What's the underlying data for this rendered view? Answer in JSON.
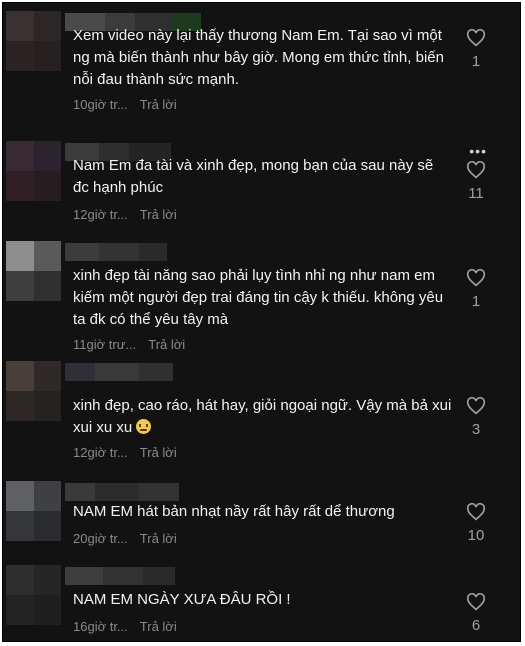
{
  "comments": [
    {
      "text": "Xem video này lại thấy thương Nam Em. Tại sao vì một ng mà biến thành như bây giờ. Mong em thức tỉnh, biến nỗi đau thành sức mạnh.",
      "time": "10giờ tr...",
      "reply": "Trả lời",
      "likes": "1",
      "avatar_colors": [
        "#3a3232",
        "#2c2626",
        "#2a2424",
        "#262020"
      ],
      "name_colors": [
        "#4a4a4a",
        "#3b3b3b",
        "#2f2f2f",
        "#1e3a1e"
      ]
    },
    {
      "text": "Nam Em đa tài và xinh đẹp, mong bạn của sau này sẽ đc hạnh phúc",
      "time": "12giờ tr...",
      "reply": "Trả lời",
      "likes": "11",
      "more": "•••",
      "avatar_colors": [
        "#3a2a33",
        "#2c2330",
        "#302026",
        "#251d22"
      ],
      "name_colors": [
        "#3b3b3b",
        "#2e2e2e",
        "#242424"
      ]
    },
    {
      "text": "xinh đẹp tài năng sao phải lụy tình nhỉ ng như nam em kiếm một người đẹp trai đáng tin cậy k thiếu. không yêu ta đk có thể yêu tây mà",
      "time": "11giờ trư...",
      "reply": "Trả lời",
      "likes": "1",
      "avatar_colors": [
        "#8e8e8e",
        "#5a5a5a",
        "#3e3e3e",
        "#303030"
      ],
      "name_colors": [
        "#3c3c3c",
        "#333333",
        "#2a2a2a"
      ]
    },
    {
      "text": "xinh đẹp, cao ráo, hát hay, giỏi ngoại ngữ. Vậy mà bả xui xui xu xu",
      "time": "12giờ tr...",
      "reply": "Trả lời",
      "likes": "3",
      "avatar_colors": [
        "#4a3e3a",
        "#2f2a28",
        "#2d2826",
        "#262220"
      ],
      "name_colors": [
        "#2f2f3a",
        "#3a3a3a",
        "#303030"
      ]
    },
    {
      "text": "NAM EM hát bản nhạt nầy rất hây rất dể thương",
      "time": "20giờ tr...",
      "reply": "Trả lời",
      "likes": "10",
      "avatar_colors": [
        "#5e6064",
        "#3e4044",
        "#34363a",
        "#2a2c30"
      ],
      "name_colors": [
        "#3a3a3a",
        "#2c2c2c",
        "#333333"
      ]
    },
    {
      "text": "NAM EM NGÀY XƯA ĐÂU RỒI !",
      "time": "16giờ tr...",
      "reply": "Trả lời",
      "likes": "6",
      "avatar_colors": [
        "#2e2e2e",
        "#262626",
        "#232323",
        "#1f1f1f"
      ],
      "name_colors": [
        "#3e3e3e",
        "#333333",
        "#2a2a2a"
      ]
    }
  ]
}
